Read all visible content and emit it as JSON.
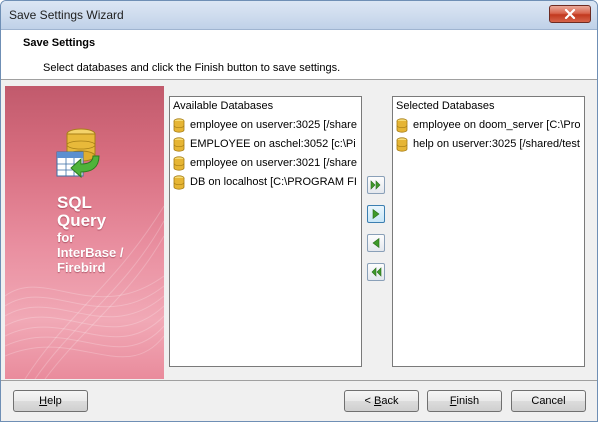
{
  "window": {
    "title": "Save Settings Wizard"
  },
  "header": {
    "title": "Save Settings",
    "description": "Select databases and click the Finish button to save settings."
  },
  "sidebar": {
    "product_lines": [
      "SQL",
      "Query",
      "for",
      "InterBase /",
      "Firebird"
    ]
  },
  "available": {
    "header": "Available Databases",
    "items": [
      "employee on userver:3025 [/share",
      "EMPLOYEE on aschel:3052 [c:\\Pi",
      "employee on userver:3021 [/share",
      "DB on localhost [C:\\PROGRAM FI"
    ]
  },
  "selected": {
    "header": "Selected Databases",
    "items": [
      "employee on doom_server [C:\\Pro",
      "help on userver:3025 [/shared/test"
    ]
  },
  "buttons": {
    "help_mnemonic": "H",
    "help_rest": "elp",
    "back_prefix": "< ",
    "back_mnemonic": "B",
    "back_rest": "ack",
    "finish_mnemonic": "F",
    "finish_rest": "inish",
    "cancel": "Cancel"
  },
  "colors": {
    "arrow_green": "#3e9a2a",
    "accent_pink": "#d86e80"
  }
}
